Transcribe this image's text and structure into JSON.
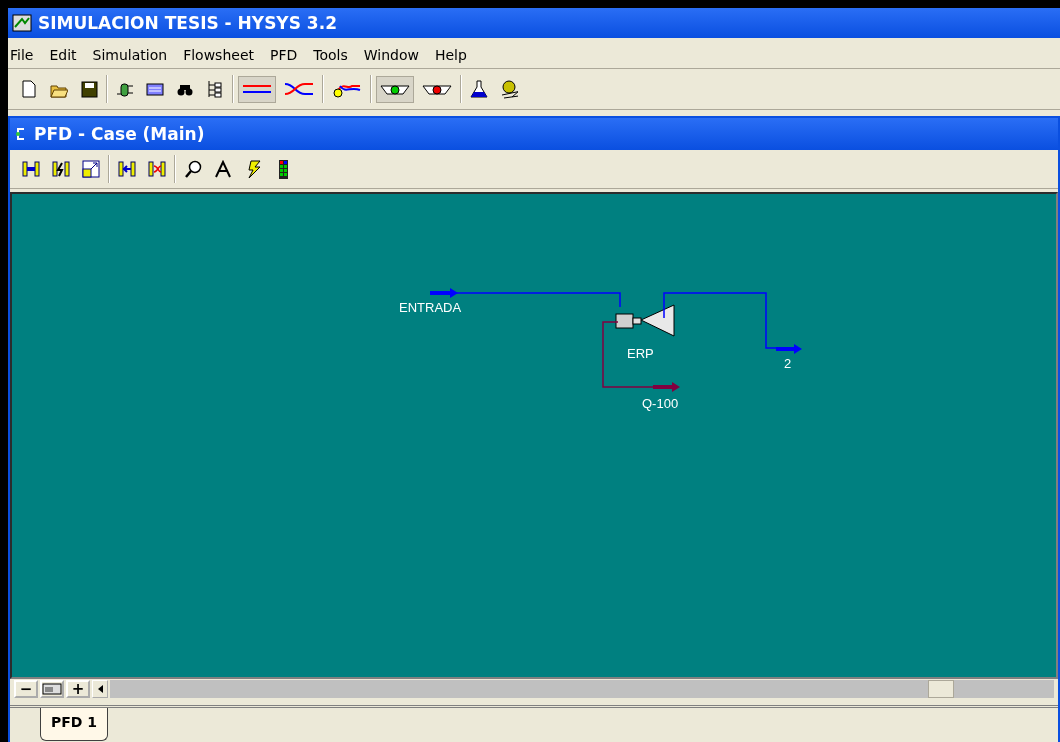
{
  "window": {
    "title": "SIMULACION TESIS - HYSYS 3.2"
  },
  "menu": [
    "File",
    "Edit",
    "Simulation",
    "Flowsheet",
    "PFD",
    "Tools",
    "Window",
    "Help"
  ],
  "toolbar": [
    [
      {
        "selected": false
      },
      {
        "selected": false
      },
      {
        "selected": false
      }
    ],
    [
      {
        "selected": false
      },
      {
        "selected": false
      },
      {
        "selected": false
      },
      {
        "selected": false
      }
    ],
    [
      {
        "selected": true
      },
      {
        "selected": false
      }
    ],
    [
      {
        "selected": false
      }
    ],
    [
      {
        "selected": true
      },
      {
        "selected": false
      }
    ],
    [
      {
        "selected": false
      },
      {
        "selected": false
      }
    ]
  ],
  "pfd": {
    "title": "PFD - Case (Main)",
    "toolbar": [
      [
        {
          "selected": false
        },
        {
          "selected": false
        },
        {
          "selected": false
        }
      ],
      [
        {
          "selected": false
        },
        {
          "selected": false
        }
      ],
      [
        {
          "selected": false
        },
        {
          "selected": false
        },
        {
          "selected": false
        },
        {
          "selected": false
        }
      ]
    ],
    "unit": {
      "label": "ERP"
    },
    "streams": [
      {
        "label": "ENTRADA",
        "kind": "material"
      },
      {
        "label": "2",
        "kind": "material"
      },
      {
        "label": "Q-100",
        "kind": "energy"
      }
    ],
    "zoom_buttons": [
      "−",
      "+"
    ],
    "tabs": [
      {
        "label": "PFD 1",
        "selected": true
      }
    ]
  }
}
